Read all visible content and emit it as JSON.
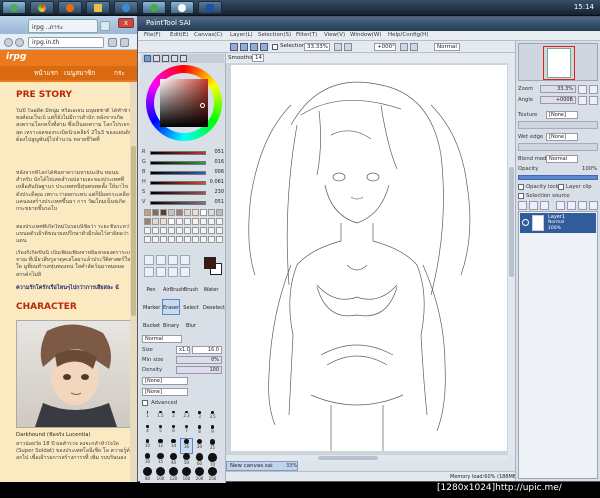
{
  "taskbar": {
    "clock": "15:14",
    "buttons": [
      "start-orb",
      "chrome",
      "firefox",
      "folder",
      "explorer",
      "messenger",
      "sai-app",
      "photoshop"
    ]
  },
  "browser": {
    "tab_title": "irpg ..ภาระ",
    "address": "irpg.in.th",
    "close_label": "x",
    "logo": "irpg",
    "nav": [
      "หน้าแรก",
      "เนนูสมาชิก",
      "กระ"
    ],
    "sections": {
      "pre_story_title": "PRE STORY",
      "pre_story_p1": "ในปี ในอดีต มีหนุ่ม หรือเอเจน มนุษยชาติ ได้ทำข้ามพงศ์อนเว็บเบ้ แต่ก็ยังไม่มีการสำนัก หลังจากเกิดสงครามโลกครั้งที่สาม ซึ่งเป็นสงคราม โลกโปรเจกต์สุด เหราะผลของระเบิดนิวเคลียร์ 2ใน3 ของแผ่นดิน ต้องไปสูญพันธุ์ไปจำนวน หลายชีวิตที่",
      "pre_story_p2": "หลังจากที่โลกได้พ้นหาความหายนะสิ้น หมนมสำหรับ นักได้ไข่เสดสำเนปลายเละของประเทศทีเหลือสันนิษฐานร ประเทศหนีหุ่นทบทดตั้ง ให้มาไขดังประดีคุณ เพราะว่าผลกระทบ แต่ก็มีผลกระเคลือนแคนลงสร้างประเทศขึ้นมา การ วัฒโถมเบ็นจ่เกิดกระขยายขึ้นรอโบ",
      "pre_story_p3": "สองประเทศที่เกิดใหม่ในรอบนี้ชื่อว่า ระยะชั้นระหว่า แขนดตัวเฝ้าติขณาผลปรีกษาตัวมีกล้อไว้สาธิตอว่าแดน",
      "pre_story_p4": "เรื่องกีเกิดขึ้นนี้ เป็นเพียงเพียงจาหยื่องกลองตราระเบจาณ ทีเมียวสีหรูอาดุคเลโอผาแล้วประวีติศาสตร์ใหม่ใด มูพี่ยนทำรสหุ่นทองคน่ ใสคำลัตว์นมาหมดผลสรรค์กไม่สิ",
      "thai_bold": "ความรักโครักเรือไหนๆไปกว่าการเสียสละ ฉั",
      "character_title": "CHARACTER",
      "char_name": "Darkhound (ชื่อจริง Lucentia)",
      "char_desc": "สาวน้อยวัย 18 ปี ผลสำรวจ ลงจะกล่ำหัวใจใด (Super Soldat) ของประเทศโลนีเชีย โล ความรู้ต้นอกไป เพื่อเฝ้ารอการสร้างการรที่ เพิ่ม รบบริษนลง"
    }
  },
  "sai": {
    "title": "PaintTool SAI",
    "menu": [
      "File(F)",
      "Edit(E)",
      "Canvas(C)",
      "Layer(L)",
      "Selection(S)",
      "Filter(T)",
      "View(V)",
      "Window(W)",
      "Help/Config(H)"
    ],
    "toolbar": {
      "selection_label": "Selection",
      "zoom": "33.33%",
      "angle": "+000°",
      "mode": "Normal"
    },
    "smoothing_label": "Smoothing",
    "smoothing_value": "14",
    "color_sliders": [
      {
        "label": "R",
        "value": "051",
        "color": "#c0392b"
      },
      {
        "label": "G",
        "value": "016",
        "color": "#2e9e3a"
      },
      {
        "label": "B",
        "value": "006",
        "color": "#2b5fc0"
      },
      {
        "label": "H",
        "value": "0.061",
        "color": "#e04a2a"
      },
      {
        "label": "S",
        "value": "230",
        "color": "#a0505a"
      },
      {
        "label": "V",
        "value": "051",
        "color": "#7a7a7a"
      }
    ],
    "tools": [
      {
        "label": "Pen",
        "sel": false
      },
      {
        "label": "AirBrush",
        "sel": false
      },
      {
        "label": "Brush",
        "sel": false
      },
      {
        "label": "Water",
        "sel": false
      },
      {
        "label": "Marker",
        "sel": false
      },
      {
        "label": "Eraser",
        "sel": true
      },
      {
        "label": "Select",
        "sel": false
      },
      {
        "label": "Deselect",
        "sel": false
      },
      {
        "label": "Bucket",
        "sel": false
      },
      {
        "label": "Binary",
        "sel": false
      },
      {
        "label": "Blur",
        "sel": false
      },
      {
        "label": "",
        "sel": false
      }
    ],
    "brush": {
      "mode": "Normal",
      "size_label": "Size",
      "size_mult": "x1.0",
      "size_value": "16.0",
      "minsize_label": "Min size",
      "minsize_value": "0%",
      "density_label": "Density",
      "density_value": "100",
      "shape": "[None]",
      "texture": "[None]",
      "advanced_label": "Advanced",
      "dot_sizes": [
        "1",
        "1.5",
        "2",
        "2.3",
        "3",
        "3.5",
        "4",
        "5",
        "6",
        "7",
        "8",
        "9",
        "10",
        "12",
        "14",
        "16",
        "20",
        "25",
        "30",
        "35",
        "40",
        "50",
        "60",
        "70",
        "80",
        "100",
        "120",
        "160",
        "200",
        "250",
        "300",
        "350",
        "400",
        "500"
      ]
    },
    "file_tab": {
      "name": "New canvas.sai",
      "zoom": "33%"
    },
    "status": {
      "memory": "Memory load:60% (188MB / 733MB)",
      "keys": [
        "Shift",
        "Ctrl",
        "Alt",
        "SPC",
        "Any"
      ]
    },
    "right_panel": {
      "zoom_label": "Zoom",
      "zoom_value": "33.3%",
      "angle_label": "Angle",
      "angle_value": "+000B",
      "texture_label": "Texture",
      "texture_value": "[None]",
      "wetedge_label": "Wet edge",
      "wetedge_value": "[None]",
      "blend_label": "Blend mode",
      "blend_value": "Normal",
      "opacity_label": "Opacity",
      "opacity_value": "100%",
      "opacity_lock": "Opacity lock",
      "layer_clip": "Layer clip",
      "selection_source": "Selection source",
      "layer": {
        "name": "Layer1",
        "mode": "Normal",
        "opacity": "100%"
      }
    }
  },
  "caption": "[1280x1024]http://upic.me/"
}
